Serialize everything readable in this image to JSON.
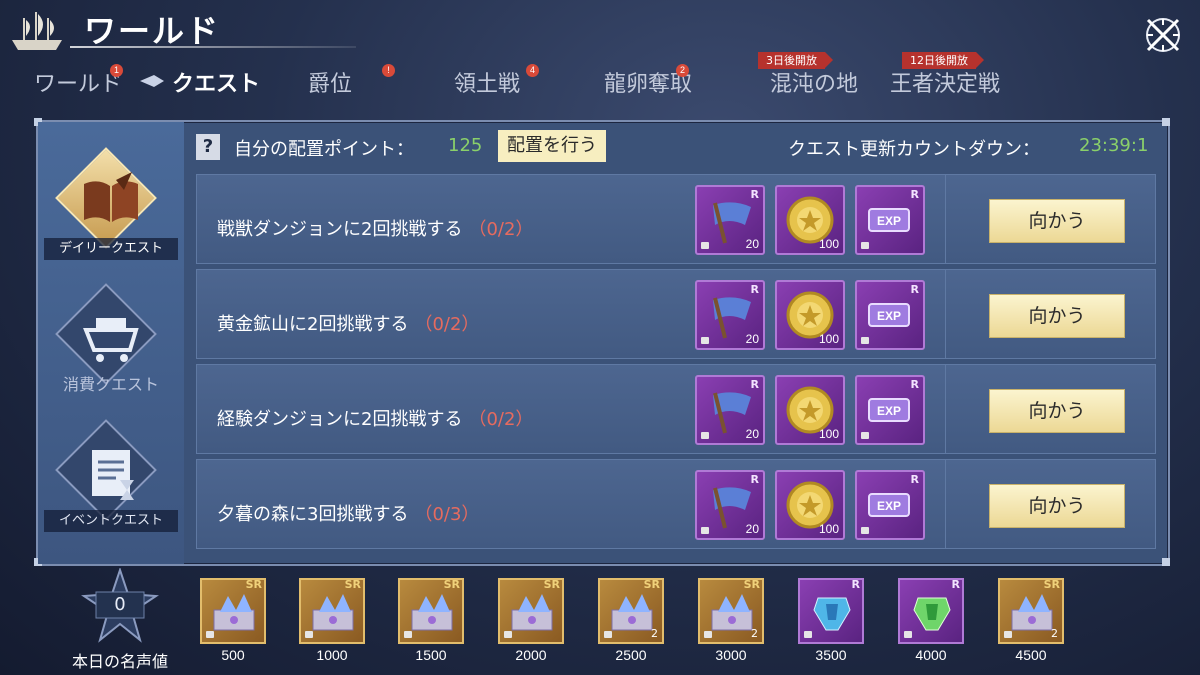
{
  "header": {
    "title": "ワールド"
  },
  "tabs": [
    {
      "label": "ワールド",
      "badge": "1"
    },
    {
      "label": "クエスト"
    },
    {
      "label": "爵位",
      "badge": "!"
    },
    {
      "label": "領土戦",
      "badge": "4"
    },
    {
      "label": "龍卵奪取",
      "badge": "2"
    },
    {
      "label": "混沌の地",
      "ribbon": "3日後開放"
    },
    {
      "label": "王者決定戦",
      "ribbon": "12日後開放"
    }
  ],
  "sidebar": {
    "categories": [
      {
        "label": "デイリークエスト"
      },
      {
        "label": "消費クエスト"
      },
      {
        "label": "イベントクエスト"
      }
    ]
  },
  "topbar": {
    "help": "?",
    "points_label": "自分の配置ポイント：",
    "points_value": "125",
    "place_button": "配置を行う",
    "countdown_label": "クエスト更新カウントダウン：",
    "countdown_value": "23:39:1"
  },
  "quests": [
    {
      "text": "戦獣ダンジョンに2回挑戦する",
      "progress": "（0/2）",
      "button": "向かう",
      "rewards": [
        {
          "rarity": "R",
          "count": "20"
        },
        {
          "count": "100"
        },
        {
          "rarity": "R",
          "label": "EXP"
        }
      ]
    },
    {
      "text": "黄金鉱山に2回挑戦する",
      "progress": "（0/2）",
      "button": "向かう",
      "rewards": [
        {
          "rarity": "R",
          "count": "20"
        },
        {
          "count": "100"
        },
        {
          "rarity": "R",
          "label": "EXP"
        }
      ]
    },
    {
      "text": "経験ダンジョンに2回挑戦する",
      "progress": "（0/2）",
      "button": "向かう",
      "rewards": [
        {
          "rarity": "R",
          "count": "20"
        },
        {
          "count": "100"
        },
        {
          "rarity": "R",
          "label": "EXP"
        }
      ]
    },
    {
      "text": "夕暮の森に3回挑戦する",
      "progress": "（0/3）",
      "button": "向かう",
      "rewards": [
        {
          "rarity": "R",
          "count": "20"
        },
        {
          "count": "100"
        },
        {
          "rarity": "R",
          "label": "EXP"
        }
      ]
    }
  ],
  "fame": {
    "value": "0",
    "label": "本日の名声値"
  },
  "milestones": [
    {
      "threshold": "500",
      "rarity": "SR",
      "count": ""
    },
    {
      "threshold": "1000",
      "rarity": "SR",
      "count": ""
    },
    {
      "threshold": "1500",
      "rarity": "SR",
      "count": ""
    },
    {
      "threshold": "2000",
      "rarity": "SR",
      "count": ""
    },
    {
      "threshold": "2500",
      "rarity": "SR",
      "count": "2"
    },
    {
      "threshold": "3000",
      "rarity": "SR",
      "count": "2"
    },
    {
      "threshold": "3500",
      "rarity": "R",
      "count": ""
    },
    {
      "threshold": "4000",
      "rarity": "R",
      "count": ""
    },
    {
      "threshold": "4500",
      "rarity": "SR",
      "count": "2"
    }
  ]
}
